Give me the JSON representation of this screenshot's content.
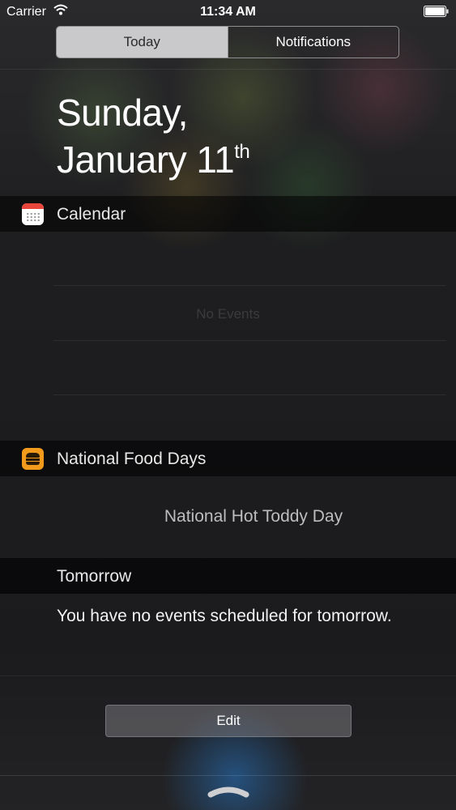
{
  "status_bar": {
    "carrier": "Carrier",
    "time": "11:34 AM",
    "wifi_icon": "wifi-icon",
    "battery_icon": "battery-icon"
  },
  "tabs": [
    {
      "label": "Today",
      "selected": true
    },
    {
      "label": "Notifications",
      "selected": false
    }
  ],
  "date": {
    "weekday": "Sunday,",
    "month_day": "January 11",
    "suffix": "th"
  },
  "calendar": {
    "title": "Calendar",
    "icon": "calendar-icon",
    "empty_text": "No Events"
  },
  "food_days": {
    "title": "National Food Days",
    "icon": "burger-icon",
    "today_item": "National Hot Toddy Day"
  },
  "tomorrow": {
    "title": "Tomorrow",
    "summary": "You have no events scheduled for tomorrow."
  },
  "footer": {
    "edit_label": "Edit",
    "grabber_icon": "grabber-icon"
  },
  "colors": {
    "segment_selected_bg": "#c9c9cb",
    "calendar_accent": "#e8453c",
    "food_icon_bg": "#f29a1b"
  }
}
